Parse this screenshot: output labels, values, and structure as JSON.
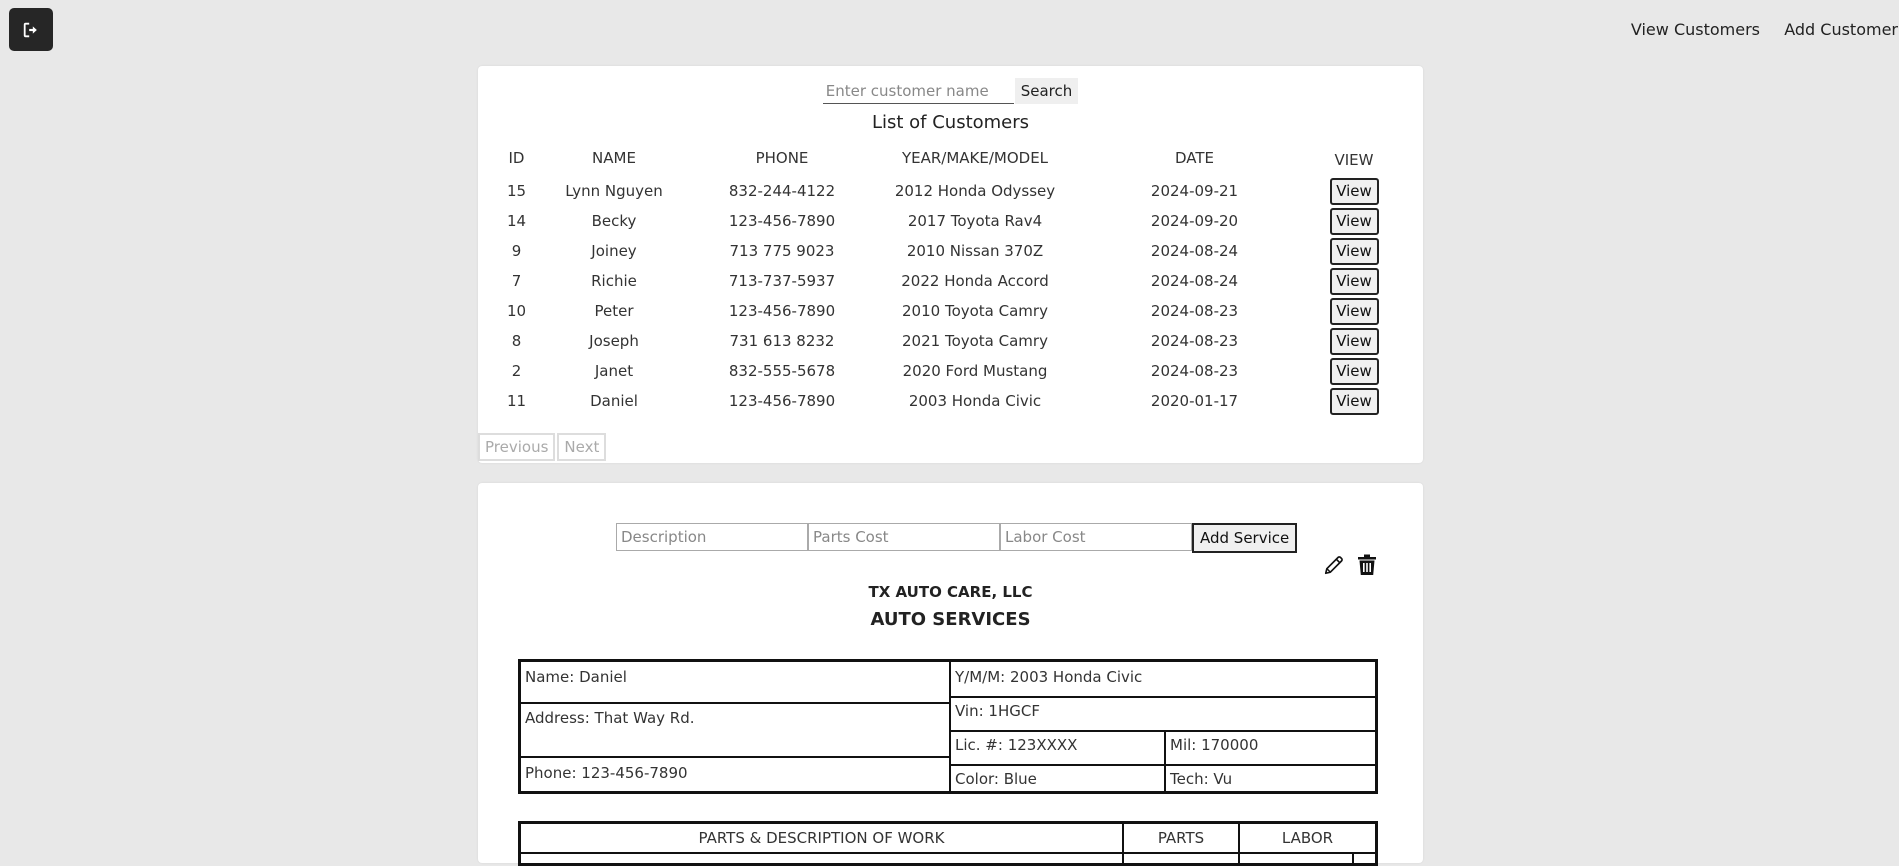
{
  "nav": {
    "view_customers": "View Customers",
    "add_customer": "Add Customer"
  },
  "search": {
    "placeholder": "Enter customer name",
    "button": "Search"
  },
  "customers": {
    "title": "List of Customers",
    "columns": [
      "ID",
      "NAME",
      "PHONE",
      "YEAR/MAKE/MODEL",
      "DATE",
      "VIEW"
    ],
    "rows": [
      {
        "id": "15",
        "name": "Lynn Nguyen",
        "phone": "832-244-4122",
        "ymm": "2012 Honda Odyssey",
        "date": "2024-09-21",
        "view": "View"
      },
      {
        "id": "14",
        "name": "Becky",
        "phone": "123-456-7890",
        "ymm": "2017 Toyota Rav4",
        "date": "2024-09-20",
        "view": "View"
      },
      {
        "id": "9",
        "name": "Joiney",
        "phone": "713 775 9023",
        "ymm": "2010 Nissan 370Z",
        "date": "2024-08-24",
        "view": "View"
      },
      {
        "id": "7",
        "name": "Richie",
        "phone": "713-737-5937",
        "ymm": "2022 Honda Accord",
        "date": "2024-08-24",
        "view": "View"
      },
      {
        "id": "10",
        "name": "Peter",
        "phone": "123-456-7890",
        "ymm": "2010 Toyota Camry",
        "date": "2024-08-23",
        "view": "View"
      },
      {
        "id": "8",
        "name": "Joseph",
        "phone": "731 613 8232",
        "ymm": "2021 Toyota Camry",
        "date": "2024-08-23",
        "view": "View"
      },
      {
        "id": "2",
        "name": "Janet",
        "phone": "832-555-5678",
        "ymm": "2020 Ford Mustang",
        "date": "2024-08-23",
        "view": "View"
      },
      {
        "id": "11",
        "name": "Daniel",
        "phone": "123-456-7890",
        "ymm": "2003 Honda Civic",
        "date": "2020-01-17",
        "view": "View"
      }
    ],
    "previous": "Previous",
    "next": "Next"
  },
  "service_form": {
    "description_placeholder": "Description",
    "parts_placeholder": "Parts Cost",
    "labor_placeholder": "Labor Cost",
    "add_button": "Add Service"
  },
  "invoice": {
    "company": "TX AUTO CARE, LLC",
    "title": "AUTO SERVICES",
    "name": "Name: Daniel",
    "address": "Address: That Way Rd.",
    "phone": "Phone: 123-456-7890",
    "ymm": "Y/M/M: 2003 Honda Civic",
    "vin": "Vin: 1HGCF",
    "lic": "Lic. #: 123XXXX",
    "mil": "Mil: 170000",
    "color": "Color: Blue",
    "tech": "Tech: Vu",
    "work_headers": [
      "PARTS & DESCRIPTION OF WORK",
      "PARTS",
      "LABOR"
    ]
  },
  "icons": {
    "logout": "logout-icon",
    "edit": "pencil-icon",
    "delete": "trash-icon"
  }
}
